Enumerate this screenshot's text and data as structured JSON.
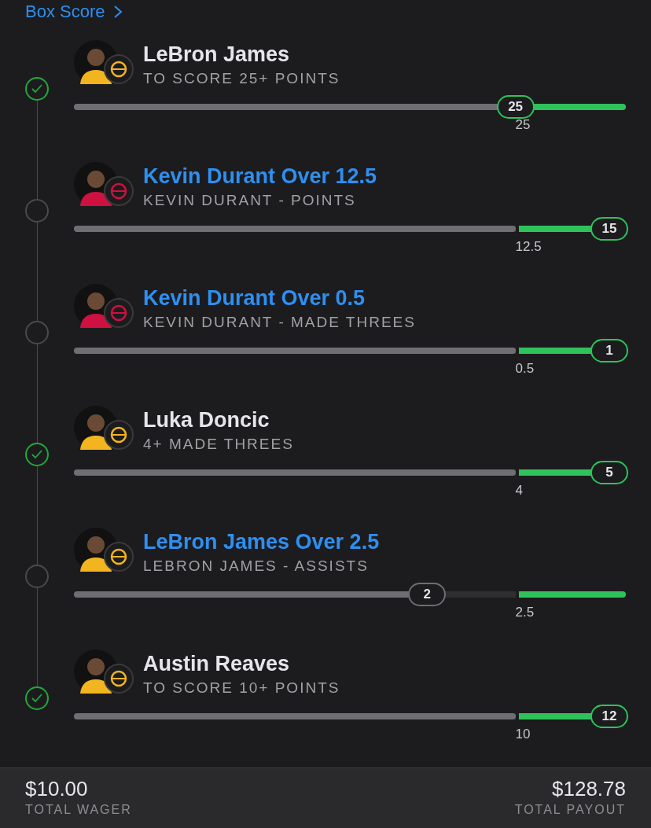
{
  "box_score_link": "Box Score",
  "legs": [
    {
      "kind": "milestone",
      "title": "LeBron James",
      "subtitle": "TO SCORE 25+ POINTS",
      "checked": true,
      "reached": true,
      "level": 0.8,
      "current": "25",
      "threshold": "25",
      "color": "#f2b51f"
    },
    {
      "kind": "line",
      "title": "Kevin Durant Over 12.5",
      "subtitle": "KEVIN DURANT - POINTS",
      "checked": false,
      "reached": true,
      "level": 0.97,
      "current": "15",
      "threshold": "12.5",
      "color": "#ce1141"
    },
    {
      "kind": "line",
      "title": "Kevin Durant Over 0.5",
      "subtitle": "KEVIN DURANT - MADE THREES",
      "checked": false,
      "reached": true,
      "level": 0.97,
      "current": "1",
      "threshold": "0.5",
      "color": "#ce1141"
    },
    {
      "kind": "milestone",
      "title": "Luka Doncic",
      "subtitle": "4+ MADE THREES",
      "checked": true,
      "reached": true,
      "level": 0.97,
      "current": "5",
      "threshold": "4",
      "color": "#f2b51f"
    },
    {
      "kind": "line",
      "title": "LeBron James Over 2.5",
      "subtitle": "LEBRON JAMES - ASSISTS",
      "checked": false,
      "reached": false,
      "level": 0.64,
      "current": "2",
      "threshold": "2.5",
      "color": "#f2b51f"
    },
    {
      "kind": "milestone",
      "title": "Austin Reaves",
      "subtitle": "TO SCORE 10+ POINTS",
      "checked": true,
      "reached": true,
      "level": 0.97,
      "current": "12",
      "threshold": "10",
      "color": "#f2b51f"
    }
  ],
  "footer": {
    "wager": "$10.00",
    "wager_label": "TOTAL WAGER",
    "payout": "$128.78",
    "payout_label": "TOTAL PAYOUT"
  }
}
